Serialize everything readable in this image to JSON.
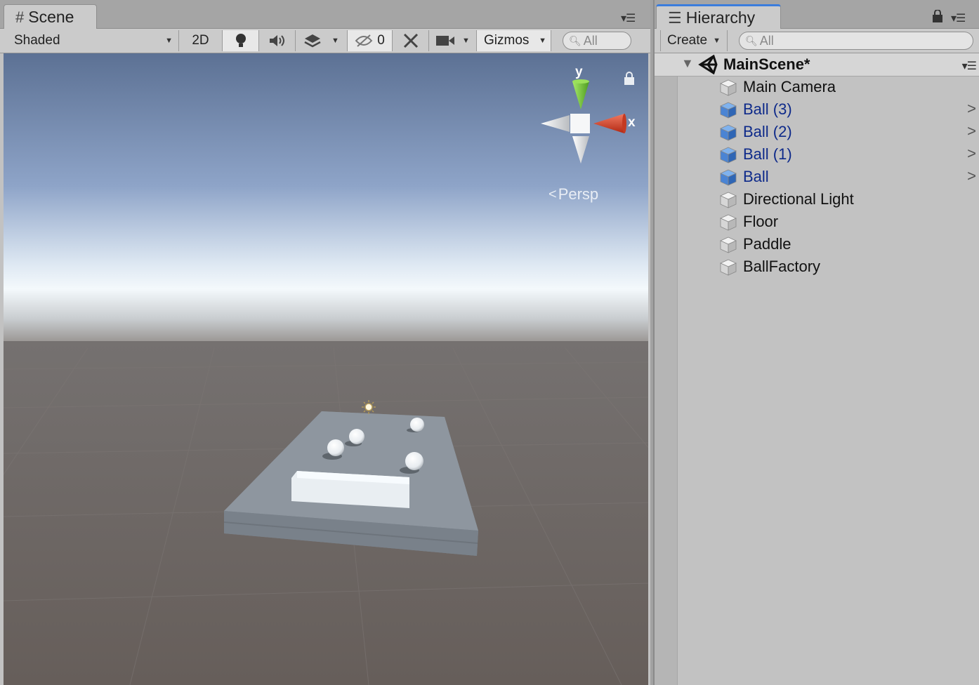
{
  "scene_panel": {
    "tab_title": "Scene",
    "toolbar": {
      "shading_mode": "Shaded",
      "mode_2d": "2D",
      "hidden_count": "0",
      "gizmos_label": "Gizmos",
      "search_placeholder": "All"
    },
    "gizmo": {
      "y_label": "y",
      "x_label": "x",
      "projection_label": "Persp"
    }
  },
  "hierarchy_panel": {
    "tab_title": "Hierarchy",
    "create_label": "Create",
    "search_placeholder": "All",
    "scene_name": "MainScene*",
    "items": [
      {
        "label": "Main Camera",
        "prefab": false,
        "expandable": false
      },
      {
        "label": "Ball (3)",
        "prefab": true,
        "expandable": true
      },
      {
        "label": "Ball (2)",
        "prefab": true,
        "expandable": true
      },
      {
        "label": "Ball (1)",
        "prefab": true,
        "expandable": true
      },
      {
        "label": "Ball",
        "prefab": true,
        "expandable": true
      },
      {
        "label": "Directional Light",
        "prefab": false,
        "expandable": false
      },
      {
        "label": "Floor",
        "prefab": false,
        "expandable": false
      },
      {
        "label": "Paddle",
        "prefab": false,
        "expandable": false
      },
      {
        "label": "BallFactory",
        "prefab": false,
        "expandable": false
      }
    ]
  },
  "colors": {
    "prefab_text": "#0e2a8a",
    "gizmo_y": "#7ed13a",
    "gizmo_x": "#e0412b",
    "ground": "#6a625e",
    "sky_top": "#5c7194"
  }
}
